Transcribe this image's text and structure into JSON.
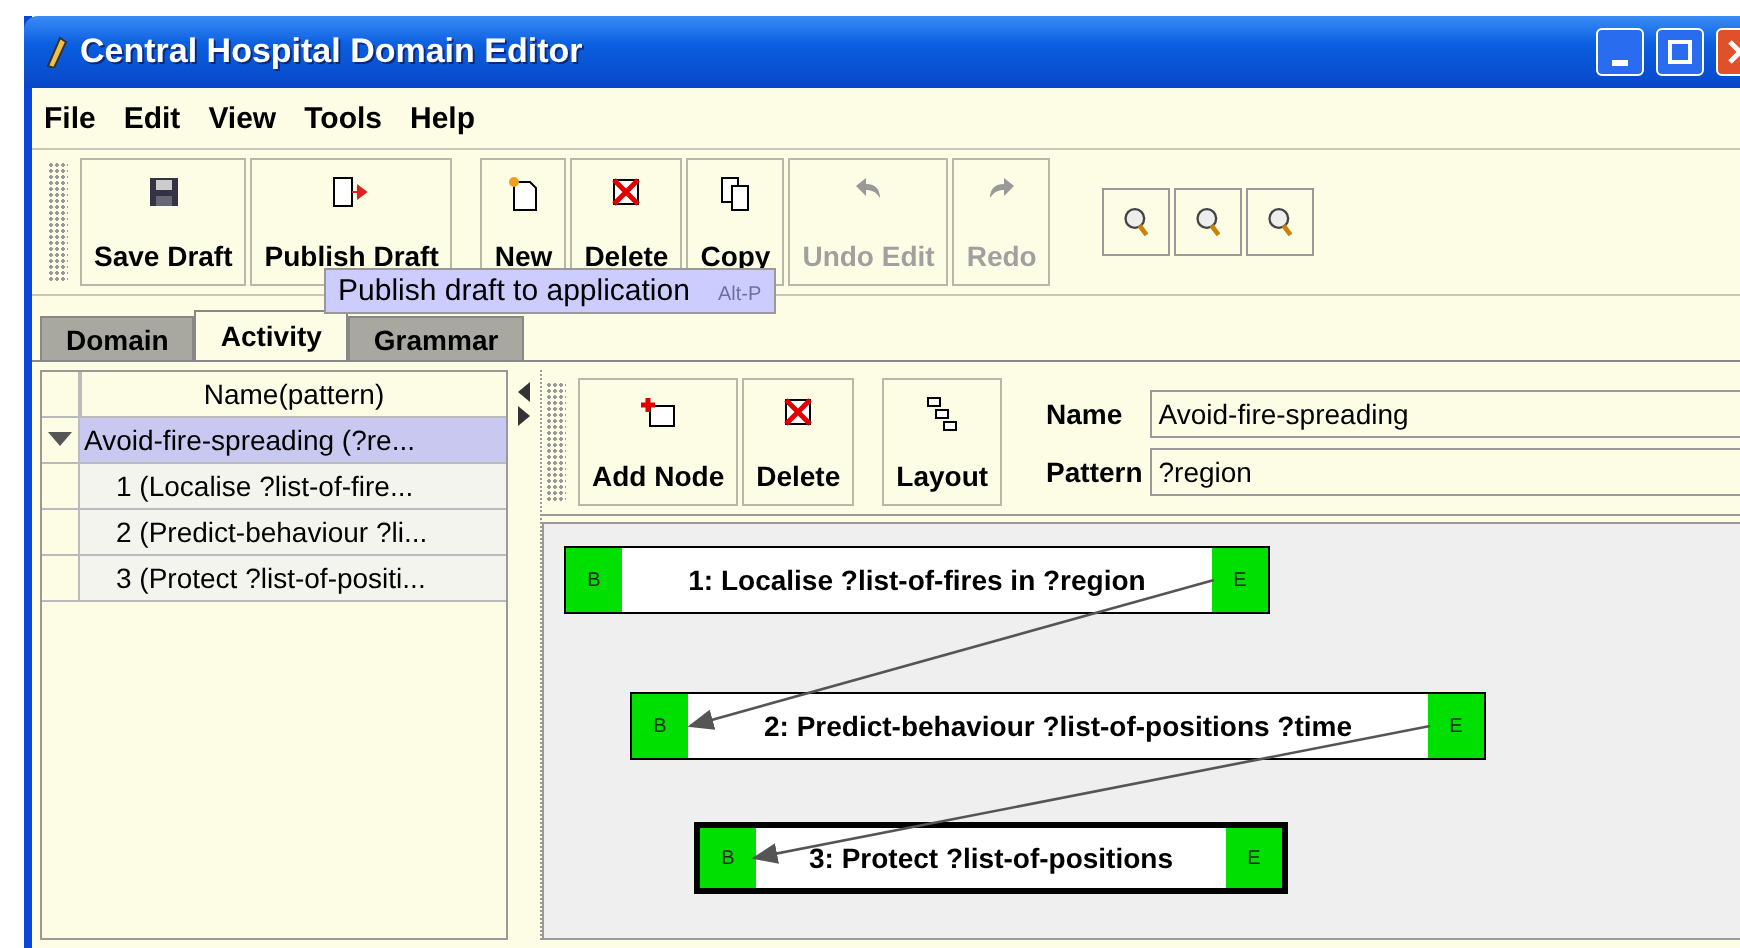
{
  "window": {
    "title": "Central Hospital Domain Editor"
  },
  "menu": [
    "File",
    "Edit",
    "View",
    "Tools",
    "Help"
  ],
  "toolbar": [
    {
      "label": "Save Draft",
      "disabled": false
    },
    {
      "label": "Publish Draft",
      "disabled": false
    },
    {
      "label": "New",
      "disabled": false
    },
    {
      "label": "Delete",
      "disabled": false
    },
    {
      "label": "Copy",
      "disabled": false
    },
    {
      "label": "Undo Edit",
      "disabled": true
    },
    {
      "label": "Redo",
      "disabled": true
    }
  ],
  "tooltip": {
    "text": "Publish draft to application",
    "shortcut": "Alt-P"
  },
  "tabs": [
    {
      "label": "Domain",
      "selected": false
    },
    {
      "label": "Activity",
      "selected": true
    },
    {
      "label": "Grammar",
      "selected": false
    }
  ],
  "table": {
    "columns": [
      "Name(pattern)"
    ],
    "rows": [
      {
        "text": "Avoid-fire-spreading (?re...",
        "selected": true,
        "expanded": true,
        "children": [
          {
            "text": "1 (Localise ?list-of-fire...",
            "selected": false
          },
          {
            "text": "2 (Predict-behaviour ?li...",
            "selected": false
          },
          {
            "text": "3 (Protect ?list-of-positi...",
            "selected": false
          }
        ]
      }
    ]
  },
  "editor": {
    "toolbar": [
      {
        "label": "Add Node"
      },
      {
        "label": "Delete"
      },
      {
        "label": "Layout"
      }
    ],
    "name_label": "Name",
    "name_value": "Avoid-fire-spreading",
    "pattern_label": "Pattern",
    "pattern_value": "?region",
    "nodes": [
      {
        "begin": "B",
        "label": "1: Localise ?list-of-fires in ?region",
        "end": "E",
        "selected": false
      },
      {
        "begin": "B",
        "label": "2: Predict-behaviour ?list-of-positions ?time",
        "end": "E",
        "selected": false
      },
      {
        "begin": "B",
        "label": "3: Protect ?list-of-positions",
        "end": "E",
        "selected": true
      }
    ]
  }
}
